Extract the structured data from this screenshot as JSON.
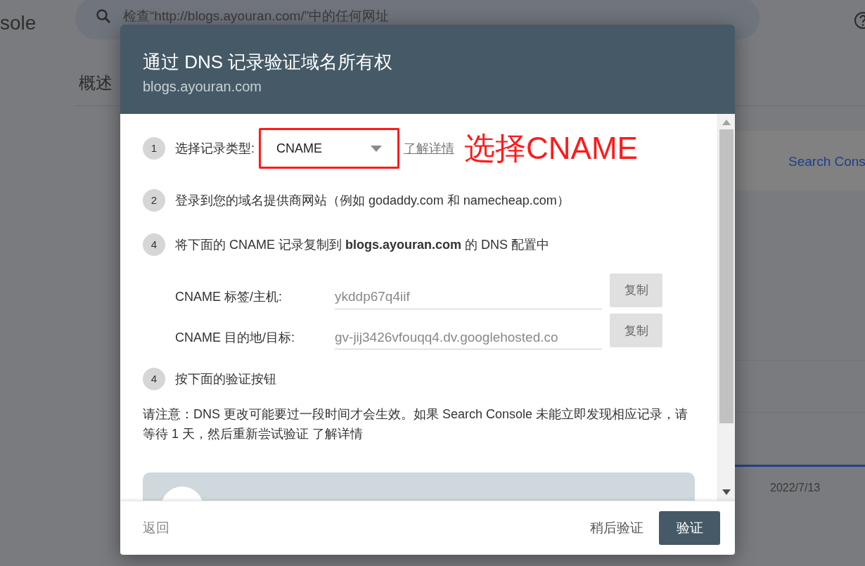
{
  "background": {
    "logo_text": "sole",
    "search": {
      "placeholder": "检查“http://blogs.ayouran.com/”中的任何网址"
    },
    "page_title": "概述",
    "link": "Search Cons",
    "date": "2022/7/13"
  },
  "dialog": {
    "title": "通过 DNS 记录验证域名所有权",
    "subtitle": "blogs.ayouran.com",
    "steps": [
      {
        "number": "1",
        "kind": "select",
        "label": "选择记录类型:",
        "value": "CNAME",
        "link": "了解详情",
        "annotation": "选择CNAME"
      },
      {
        "number": "2",
        "kind": "text",
        "text": "登录到您的域名提供商网站（例如 godaddy.com 和 namecheap.com）"
      },
      {
        "number": "4",
        "kind": "records",
        "text": "将下面的 CNAME 记录复制到 **blogs.ayouran.com** 的 DNS 配置中",
        "records": [
          {
            "label": "CNAME 标签/主机:",
            "value": "ykddp67q4iif",
            "button": "复制"
          },
          {
            "label": "CNAME 目的地/目标:",
            "value": "gv-jij3426vfouqq4.dv.googlehosted.co",
            "button": "复制"
          }
        ]
      },
      {
        "number": "4",
        "kind": "text",
        "text": "按下面的验证按钮"
      }
    ],
    "note": "请注意：DNS 更改可能要过一段时间才会生效。如果 Search Console 未能立即发现相应记录，请等待 1 天，然后重新尝试验证",
    "note_link": "了解详情",
    "footer": {
      "back": "返回",
      "later": "稍后验证",
      "verify": "验证"
    }
  }
}
